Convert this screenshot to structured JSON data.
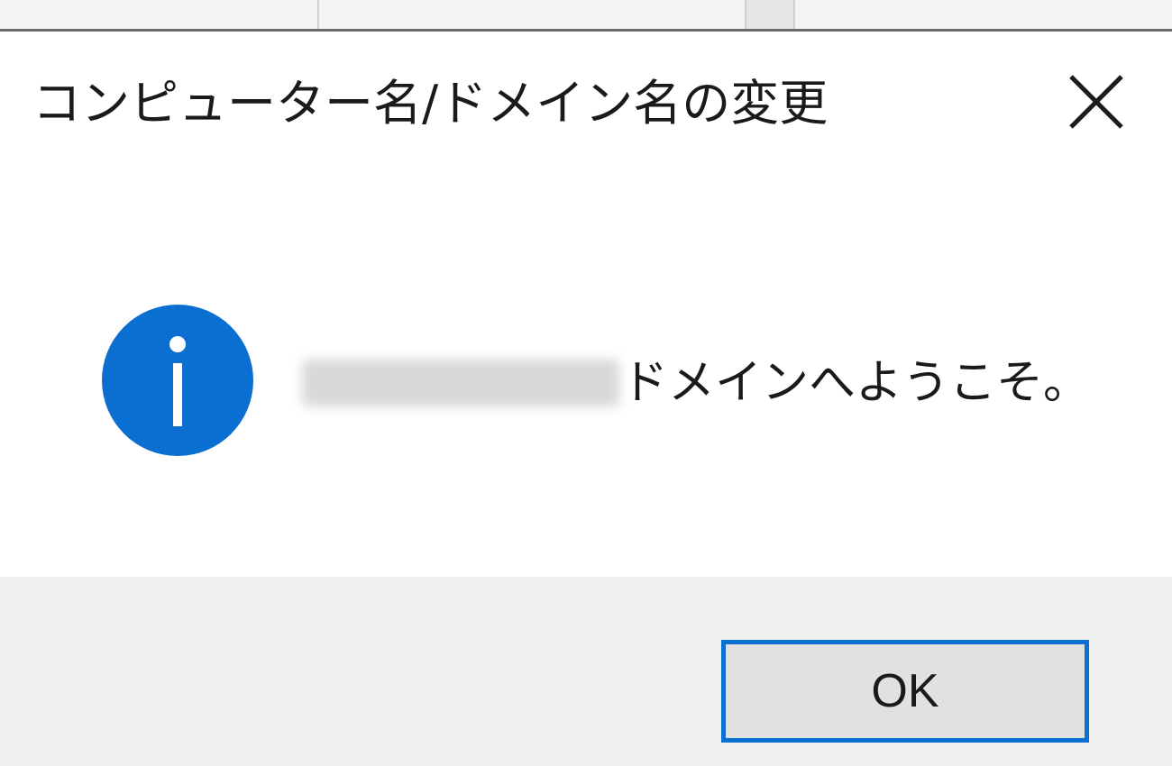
{
  "dialog": {
    "title": "コンピューター名/ドメイン名の変更",
    "close_icon": "close-icon",
    "message": {
      "icon": "info-icon",
      "redacted_domain": "",
      "text": "ドメインへようこそ。"
    },
    "ok_label": "OK"
  },
  "colors": {
    "accent": "#0a6fd0",
    "info_icon": "#0a6fd0",
    "footer_bg": "#f0f0f0",
    "button_bg": "#e1e1e1"
  }
}
